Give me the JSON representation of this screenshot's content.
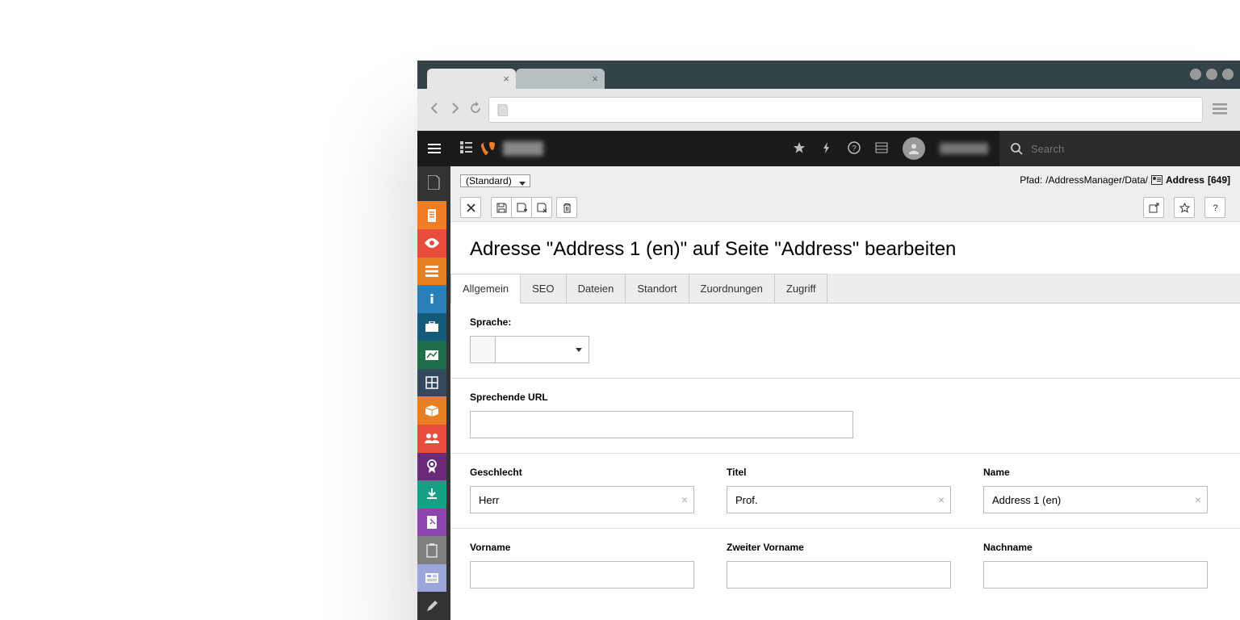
{
  "browser": {
    "tab_close": "×"
  },
  "topbar": {
    "search_placeholder": "Search"
  },
  "sidebar_colors": [
    "#f07e26",
    "#e74c3c",
    "#e67e22",
    "#2980b9",
    "#145a7a",
    "#1e6e4a",
    "#34495e",
    "#e67e22",
    "#e74c3c",
    "#6b2a7a",
    "#16a085",
    "#8e44ad",
    "#7f8c8d",
    "#9aa7d8",
    "#555"
  ],
  "content_header": {
    "select_label": "(Standard)",
    "path_label": "Pfad:",
    "path_value": "/AddressManager/Data/",
    "breadcrumb_name": "Address",
    "breadcrumb_id": "[649]"
  },
  "page": {
    "title": "Adresse \"Address 1 (en)\" auf Seite \"Address\" bearbeiten"
  },
  "tabs": [
    "Allgemein",
    "SEO",
    "Dateien",
    "Standort",
    "Zuordnungen",
    "Zugriff"
  ],
  "form": {
    "lang_label": "Sprache:",
    "url_label": "Sprechende URL",
    "url_value": "",
    "gender_label": "Geschlecht",
    "gender_value": "Herr",
    "title_label": "Titel",
    "title_value": "Prof.",
    "name_label": "Name",
    "name_value": "Address 1 (en)",
    "first_name_label": "Vorname",
    "first_name_value": "",
    "middle_name_label": "Zweiter Vorname",
    "middle_name_value": "",
    "last_name_label": "Nachname",
    "last_name_value": ""
  }
}
